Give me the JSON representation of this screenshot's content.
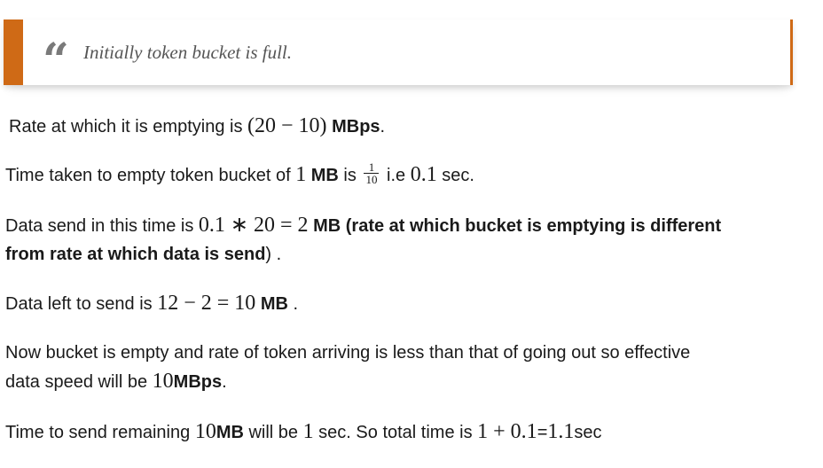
{
  "quote": {
    "mark": "“",
    "text": "Initially token bucket is full."
  },
  "colors": {
    "accent": "#cf6a16",
    "text": "#1a1a1a",
    "quote_text": "#555555"
  },
  "p1": {
    "t1": "Rate at which it is emptying is ",
    "m1": "(20 − 10)",
    "b1": "MBps",
    "t2": "."
  },
  "p2": {
    "t1": "Time taken to empty token bucket of ",
    "m1": "1",
    "b1": "MB",
    "t2": " is ",
    "frac_num": "1",
    "frac_den": "10",
    "t3": " i.e ",
    "m2": "0.1",
    "t4": " sec."
  },
  "p3": {
    "t1": "Data send in this time is ",
    "m1": "0.1 ∗ 20 = 2",
    "b1": "MB (rate at which bucket is emptying is different",
    "b2": "from rate at which data is send",
    "t2": ") ."
  },
  "p4": {
    "t1": "Data left to send is ",
    "m1": "12 − 2 = 10",
    "b1": "MB",
    "t2": " ."
  },
  "p5": {
    "line1": "Now bucket is empty and rate of token arriving is less than that of going out so effective",
    "t1": "data speed will be ",
    "m1": "10",
    "b1": "MBps",
    "t2": "."
  },
  "p6": {
    "t1": "Time to send remaining ",
    "m1": "10",
    "b1": "MB",
    "t2": " will be ",
    "m2": "1",
    "t3": " sec. So total time is ",
    "m3": "1 + 0.1",
    "t4": "=",
    "m4": "1.1",
    "t5": "sec"
  }
}
